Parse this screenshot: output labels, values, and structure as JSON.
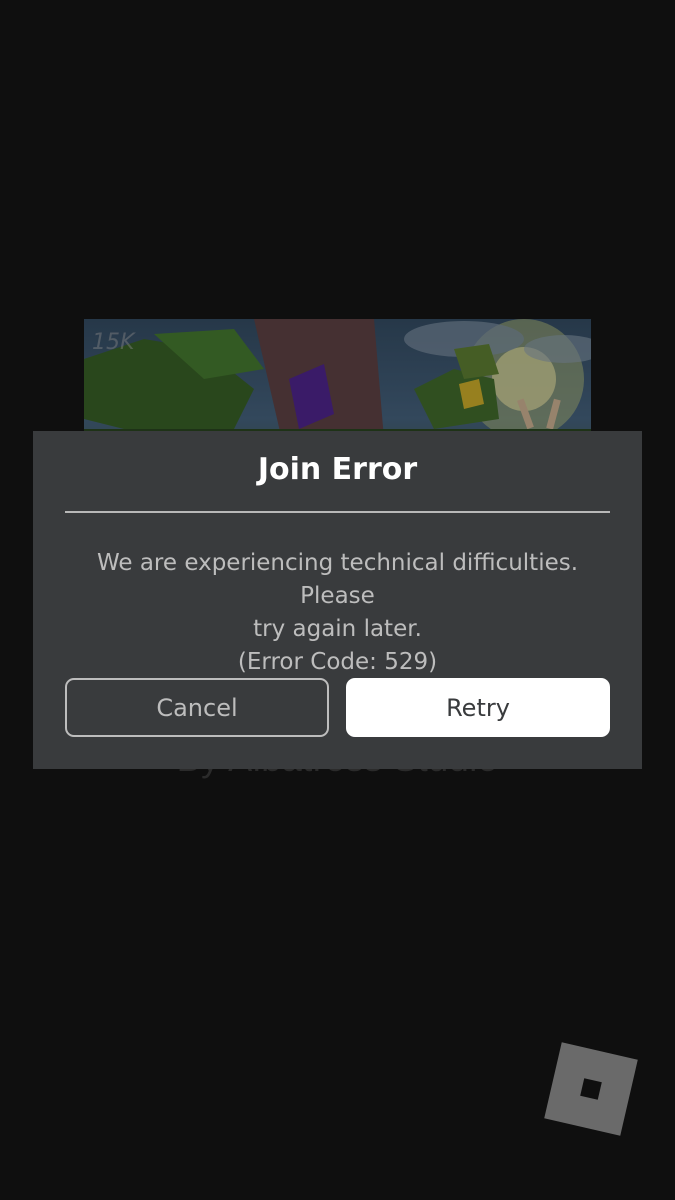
{
  "background": {
    "creator_text": "By Albatross Studio",
    "thumbnail_watermark": "15K"
  },
  "dialog": {
    "title": "Join Error",
    "message_line1": "We are experiencing technical difficulties. Please",
    "message_line2": "try again later.",
    "error_code": "(Error Code: 529)",
    "cancel_label": "Cancel",
    "retry_label": "Retry"
  },
  "colors": {
    "background": "#0f0f0f",
    "modal": "#393b3d",
    "text_primary": "#ffffff",
    "text_secondary": "#bdbdbd"
  },
  "icons": {
    "logo": "roblox-logo-icon"
  }
}
